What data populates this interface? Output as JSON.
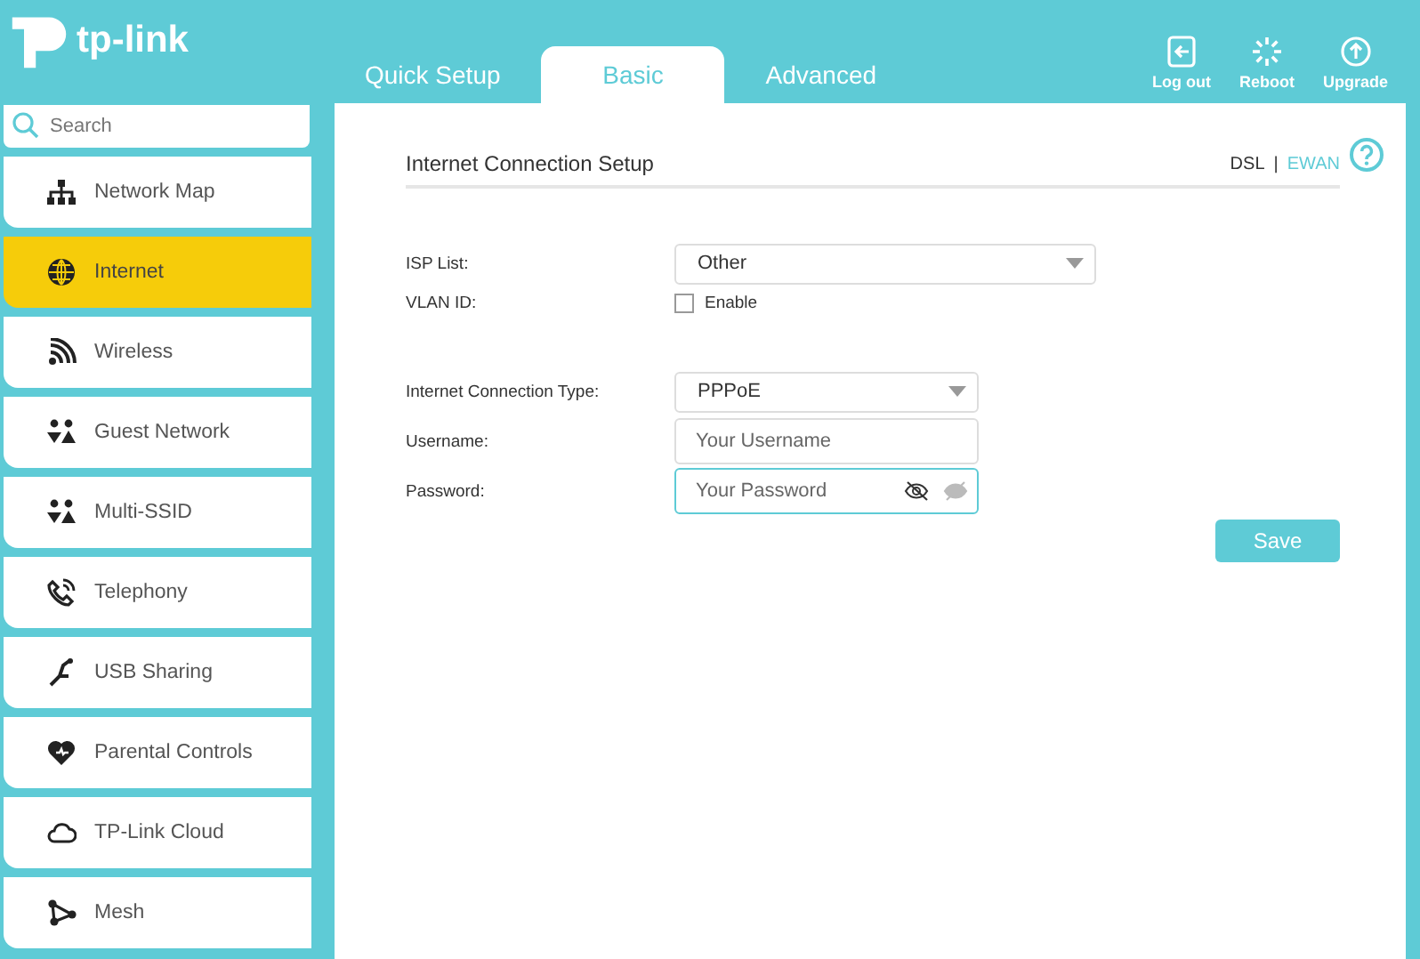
{
  "header": {
    "logo": "tp-link",
    "tabs": [
      {
        "label": "Quick Setup",
        "selected": false
      },
      {
        "label": "Basic",
        "selected": true
      },
      {
        "label": "Advanced",
        "selected": false
      }
    ],
    "actions": [
      {
        "label": "Log out",
        "kind": "logout"
      },
      {
        "label": "Reboot",
        "kind": "reboot"
      },
      {
        "label": "Upgrade",
        "kind": "upgrade"
      }
    ]
  },
  "sidebar": {
    "search": {
      "placeholder": "Search"
    },
    "items": [
      {
        "label": "Network Map",
        "kind": "map",
        "selected": false
      },
      {
        "label": "Internet",
        "kind": "globe",
        "selected": true
      },
      {
        "label": "Wireless",
        "kind": "wifi",
        "selected": false
      },
      {
        "label": "Guest Network",
        "kind": "people",
        "selected": false
      },
      {
        "label": "Multi-SSID",
        "kind": "people",
        "selected": false
      },
      {
        "label": "Telephony",
        "kind": "phone",
        "selected": false
      },
      {
        "label": "USB Sharing",
        "kind": "usb",
        "selected": false
      },
      {
        "label": "Parental Controls",
        "kind": "heart",
        "selected": false
      },
      {
        "label": "TP-Link Cloud",
        "kind": "cloud",
        "selected": false
      },
      {
        "label": "Mesh",
        "kind": "mesh",
        "selected": false
      }
    ]
  },
  "main": {
    "title": "Internet Connection Setup",
    "modes": [
      {
        "label": "DSL",
        "selected": true
      },
      {
        "label": "EWAN",
        "selected": false
      }
    ],
    "separator": "|",
    "fields": [
      {
        "label": "ISP List:",
        "kind": "select",
        "value": "Other",
        "wide": true
      },
      {
        "label": "VLAN ID:",
        "kind": "checkbox",
        "text": "Enable",
        "checked": false
      },
      {
        "kind": "spacer"
      },
      {
        "label": "Internet Connection Type:",
        "kind": "select",
        "value": "PPPoE",
        "wide": false
      },
      {
        "label": "Username:",
        "kind": "text",
        "placeholder": "Your Username"
      },
      {
        "label": "Password:",
        "kind": "password",
        "placeholder": "Your Password",
        "focused": true
      }
    ],
    "save": "Save"
  }
}
